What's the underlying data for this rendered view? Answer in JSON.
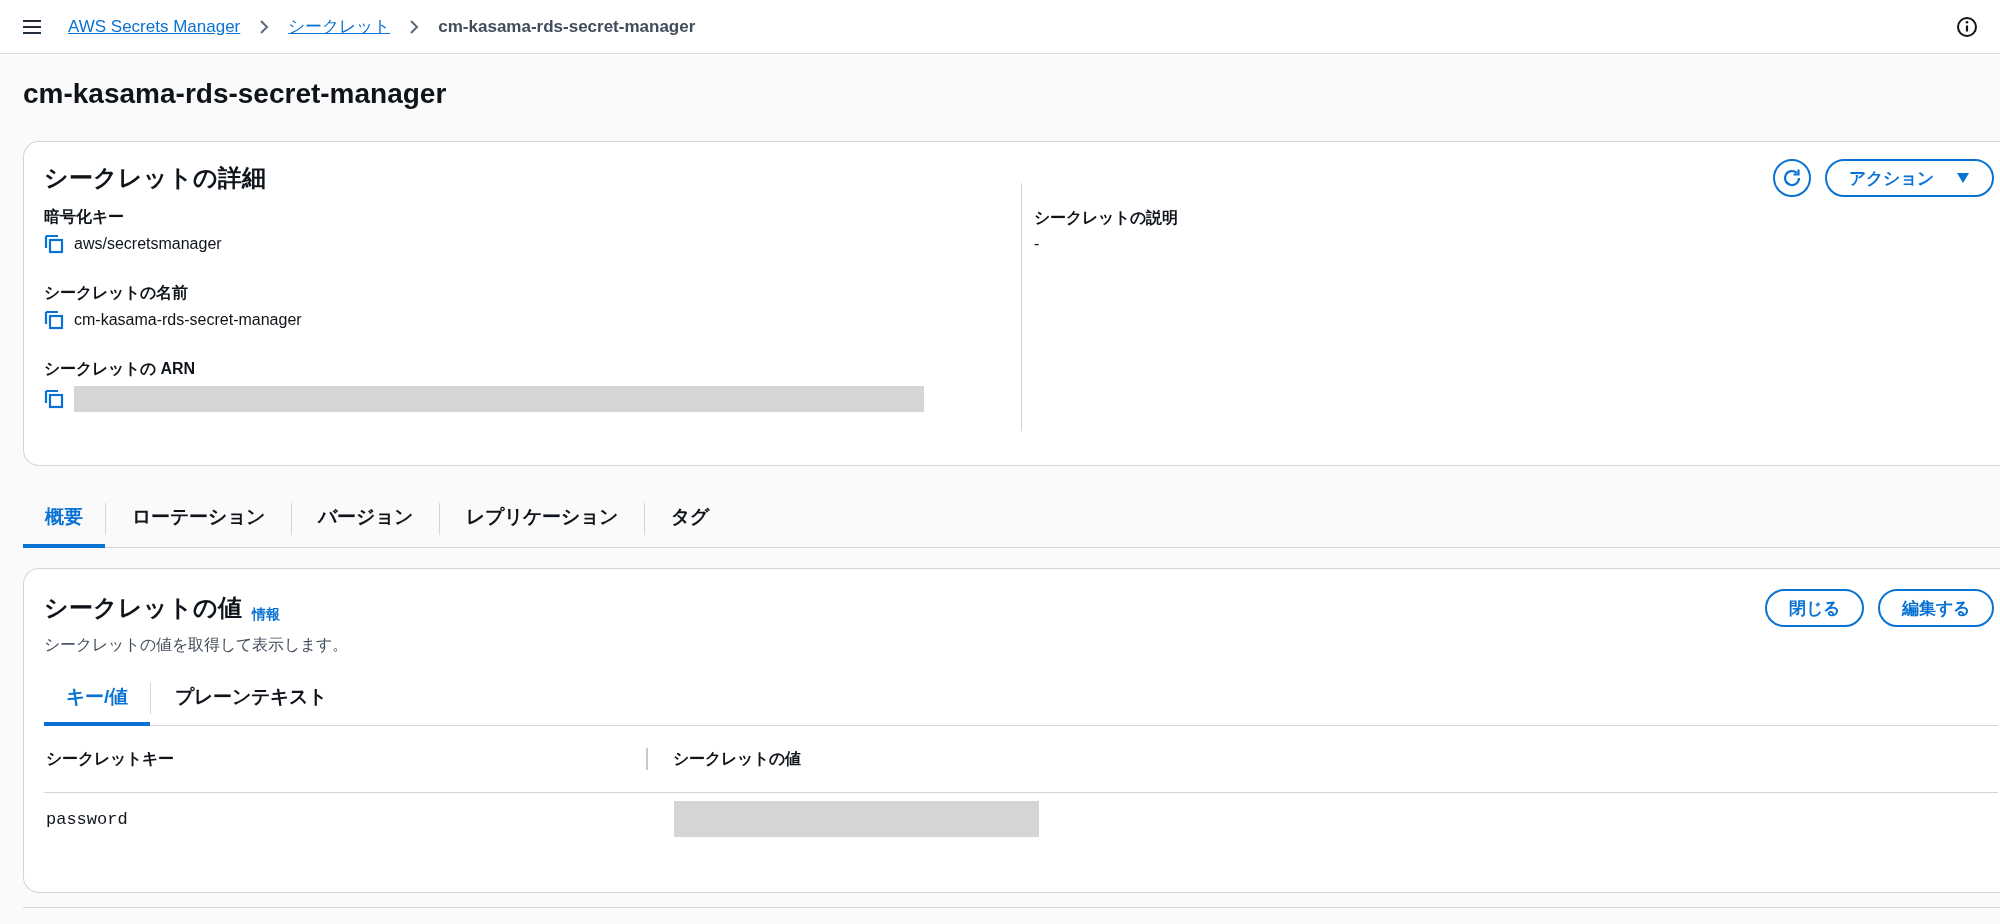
{
  "breadcrumbs": [
    {
      "label": "AWS Secrets Manager",
      "kind": "link"
    },
    {
      "label": "シークレット",
      "kind": "link"
    },
    {
      "label": "cm-kasama-rds-secret-manager",
      "kind": "current"
    }
  ],
  "page_title": "cm-kasama-rds-secret-manager",
  "details": {
    "title": "シークレットの詳細",
    "action_button": "アクション",
    "left_fields": [
      {
        "label": "暗号化キー",
        "value": "aws/secretsmanager",
        "copyable": true,
        "redacted": false
      },
      {
        "label": "シークレットの名前",
        "value": "cm-kasama-rds-secret-manager",
        "copyable": true,
        "redacted": false
      },
      {
        "label": "シークレットの ARN",
        "copyable": true,
        "redacted": true
      }
    ],
    "right_fields": [
      {
        "label": "シークレットの説明",
        "value": "-",
        "copyable": false,
        "redacted": false
      }
    ]
  },
  "tabs": [
    {
      "label": "概要",
      "selected": true
    },
    {
      "label": "ローテーション",
      "selected": false
    },
    {
      "label": "バージョン",
      "selected": false
    },
    {
      "label": "レプリケーション",
      "selected": false
    },
    {
      "label": "タグ",
      "selected": false
    }
  ],
  "secret_value": {
    "title": "シークレットの値",
    "info_link": "情報",
    "description": "シークレットの値を取得して表示します。",
    "buttons": [
      "閉じる",
      "編集する"
    ],
    "view_tabs": [
      {
        "label": "キー/値",
        "selected": true
      },
      {
        "label": "プレーンテキスト",
        "selected": false
      }
    ],
    "columns": [
      "シークレットキー",
      "シークレットの値"
    ],
    "rows": [
      {
        "key": "password",
        "value_redacted": true
      }
    ]
  }
}
